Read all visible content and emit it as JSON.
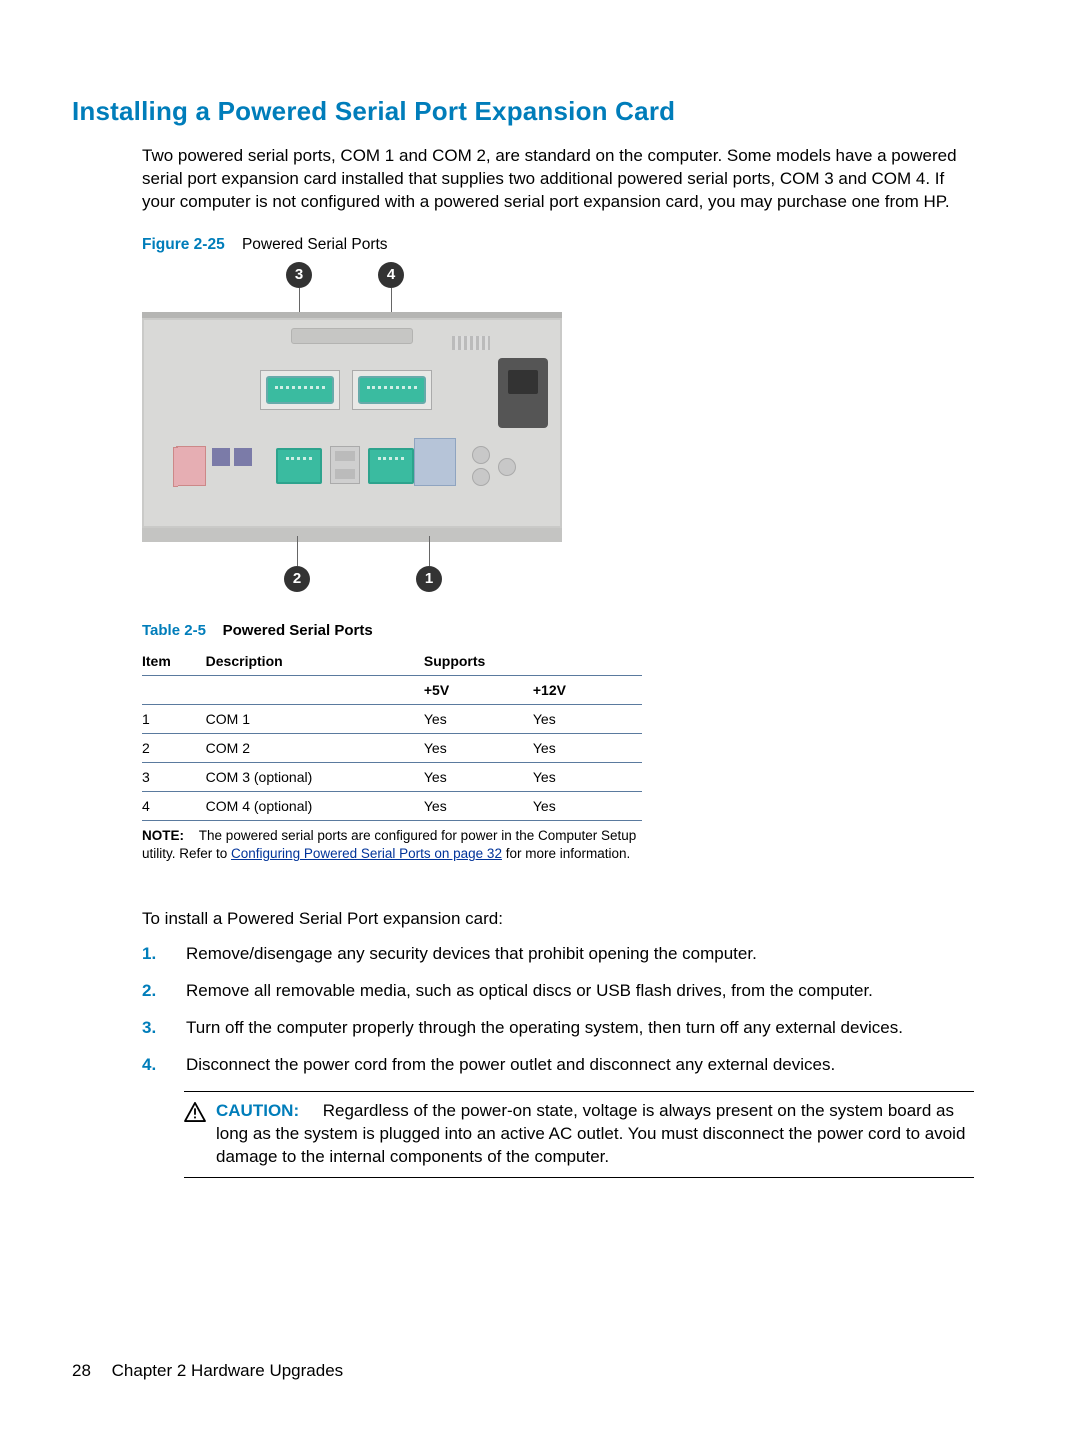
{
  "heading": "Installing a Powered Serial Port Expansion Card",
  "intro": "Two powered serial ports, COM 1 and COM 2, are standard on the computer. Some models have a powered serial port expansion card installed that supplies two additional powered serial ports, COM 3 and COM 4. If your computer is not configured with a powered serial port expansion card, you may purchase one from HP.",
  "figure": {
    "number": "Figure 2-25",
    "title": "Powered Serial Ports",
    "callouts": {
      "top_left": "3",
      "top_right": "4",
      "bottom_left": "2",
      "bottom_right": "1"
    }
  },
  "table": {
    "number": "Table 2-5",
    "title": "Powered Serial Ports",
    "headers": {
      "item": "Item",
      "description": "Description",
      "supports": "Supports",
      "v5": "+5V",
      "v12": "+12V"
    },
    "rows": [
      {
        "item": "1",
        "desc": "COM 1",
        "v5": "Yes",
        "v12": "Yes"
      },
      {
        "item": "2",
        "desc": "COM 2",
        "v5": "Yes",
        "v12": "Yes"
      },
      {
        "item": "3",
        "desc": "COM 3 (optional)",
        "v5": "Yes",
        "v12": "Yes"
      },
      {
        "item": "4",
        "desc": "COM 4 (optional)",
        "v5": "Yes",
        "v12": "Yes"
      }
    ],
    "note": {
      "label": "NOTE:",
      "before_link": "The powered serial ports are configured for power in the Computer Setup utility. Refer to ",
      "link": "Configuring Powered Serial Ports on page 32",
      "after_link": " for more information."
    }
  },
  "lead_in": "To install a Powered Serial Port expansion card:",
  "steps": [
    "Remove/disengage any security devices that prohibit opening the computer.",
    "Remove all removable media, such as optical discs or USB flash drives, from the computer.",
    "Turn off the computer properly through the operating system, then turn off any external devices.",
    "Disconnect the power cord from the power outlet and disconnect any external devices."
  ],
  "step_numbers": [
    "1.",
    "2.",
    "3.",
    "4."
  ],
  "caution": {
    "label": "CAUTION:",
    "text": "Regardless of the power-on state, voltage is always present on the system board as long as the system is plugged into an active AC outlet. You must disconnect the power cord to avoid damage to the internal components of the computer."
  },
  "footer": {
    "page": "28",
    "chapter": "Chapter 2   Hardware Upgrades"
  }
}
